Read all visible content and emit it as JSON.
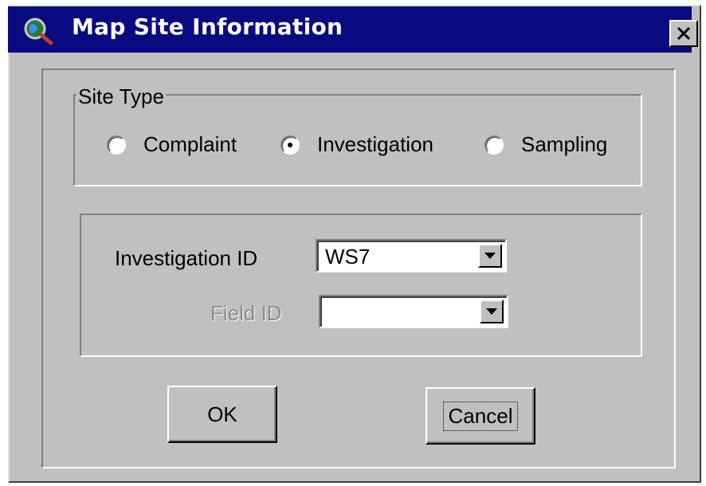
{
  "window": {
    "title": "Map Site Information",
    "title_icon": "globe-magnifier-icon",
    "close_icon": "close-icon"
  },
  "site_type": {
    "legend": "Site Type",
    "options": [
      {
        "label": "Complaint",
        "selected": false
      },
      {
        "label": "Investigation",
        "selected": true
      },
      {
        "label": "Sampling",
        "selected": false
      }
    ]
  },
  "fields": {
    "investigation_id": {
      "label": "Investigation ID",
      "value": "WS7",
      "enabled": true
    },
    "field_id": {
      "label": "Field ID",
      "value": "",
      "enabled": false
    }
  },
  "buttons": {
    "ok": "OK",
    "cancel": "Cancel"
  },
  "colors": {
    "titlebar": "#0a0a80",
    "face": "#c0c0c0"
  }
}
